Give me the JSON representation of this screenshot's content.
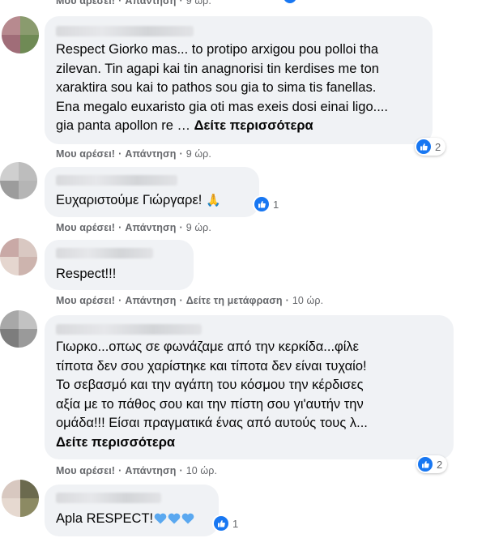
{
  "colors": {
    "accent": "#1877f2",
    "bubble": "#f0f2f5",
    "meta": "#65676b"
  },
  "labels": {
    "like": "Μου αρέσει!",
    "reply": "Απάντηση",
    "translate": "Δείτε τη μετάφραση",
    "see_more": "Δείτε περισσότερα",
    "dot": "·"
  },
  "top_actions": {
    "time": "9 ώρ."
  },
  "comments": [
    {
      "text": "Respect Giorko mas... to protipo arxigou pou polloi tha\nzilevan. Tin agapi kai tin anagnorisi tin kerdises me ton\nxaraktira sou kai to pathos sou gia to sima tis fanellas.\nEna megalo euxaristo gia oti mas exeis dosi einai ligo....\ngia panta apollon re … ",
      "time": "9 ώρ.",
      "reactions": "2",
      "reaction_icon": "like-icon"
    },
    {
      "text": "Ευχαριστούμε Γιώργαρε! ",
      "emoji": "🙏",
      "time": "9 ώρ.",
      "reactions": "1",
      "reaction_icon": "like-icon"
    },
    {
      "text": "Respect!!!",
      "time": "10 ώρ."
    },
    {
      "text": "Γιωρκο...οπως σε φωνάζαμε από την κερκίδα...φίλε\nτίποτα δεν σου χαρίστηκε και τίποτα δεν είναι τυχαίο!\nΤο σεβασμό και την αγάπη του κόσμου την κέρδισες\nαξία με το πάθος σου και την πίστη σου γι'αυτήν την\nομάδα!!! Είσαι πραγματικά ένας από αυτούς τους λ...",
      "time": "10 ώρ.",
      "reactions": "2",
      "reaction_icon": "like-icon"
    },
    {
      "text": "Apla RESPECT!",
      "reactions": "1",
      "reaction_icon": "like-icon"
    }
  ]
}
